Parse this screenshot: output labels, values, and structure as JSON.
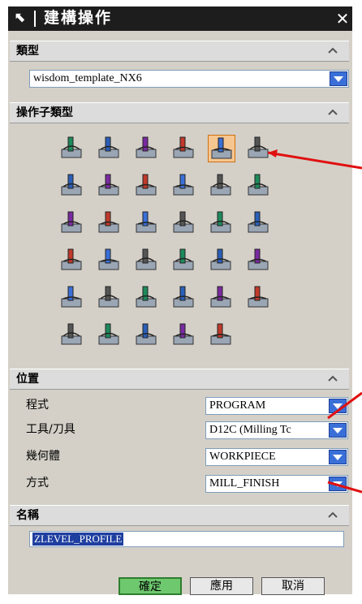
{
  "dialog": {
    "title": "建構操作",
    "title_icon": "arrow-icon",
    "close_icon": "close-icon"
  },
  "sections": {
    "type": {
      "title": "類型",
      "value": "wisdom_template_NX6"
    },
    "subtype": {
      "title": "操作子類型"
    },
    "position": {
      "title": "位置",
      "rows": [
        {
          "label": "程式",
          "value": "PROGRAM"
        },
        {
          "label": "工具/刀具",
          "value": "D12C (Milling Tc"
        },
        {
          "label": "幾何體",
          "value": "WORKPIECE"
        },
        {
          "label": "方式",
          "value": "MILL_FINISH"
        }
      ]
    },
    "name": {
      "title": "名稱",
      "value": "ZLEVEL_PROFILE"
    }
  },
  "buttons": {
    "ok": "確定",
    "apply": "應用",
    "cancel": "取消"
  },
  "colors": {
    "titlebar": "#1d1d1d",
    "accent": "#3a6fd8",
    "selected": "#f6c690",
    "arrow": "#e01010",
    "ok": "#6ec86e"
  },
  "operation_icons": [
    "cavity-mill-icon",
    "plunge-mill-icon",
    "corner-rough-icon",
    "rest-mill-icon",
    "zlevel-profile-icon",
    "zlevel-corner-icon",
    "fixed-contour-icon",
    "contour-area-icon",
    "contour-surface-area-icon",
    "streamline-icon",
    "contour-area-nonsteep-icon",
    "contour-area-dir-steep-icon",
    "flowcut-single-icon",
    "flowcut-multiple-icon",
    "flowcut-ref-tool-icon",
    "flowcut-smooth-icon",
    "contour-profile-icon",
    "variable-contour-icon",
    "variable-zlevel-icon",
    "contour-text-icon",
    "mill-control-icon",
    "mill-user-icon",
    "planar-text-icon",
    "solid-profile-icon",
    "spot-facing-icon",
    "spot-drilling-icon",
    "drilling-icon",
    "peck-drilling-icon",
    "breakchip-drilling-icon",
    "boring-icon",
    "reaming-icon",
    "counterboring-icon",
    "countersinking-icon",
    "tapping-icon",
    "thread-milling-icon"
  ]
}
